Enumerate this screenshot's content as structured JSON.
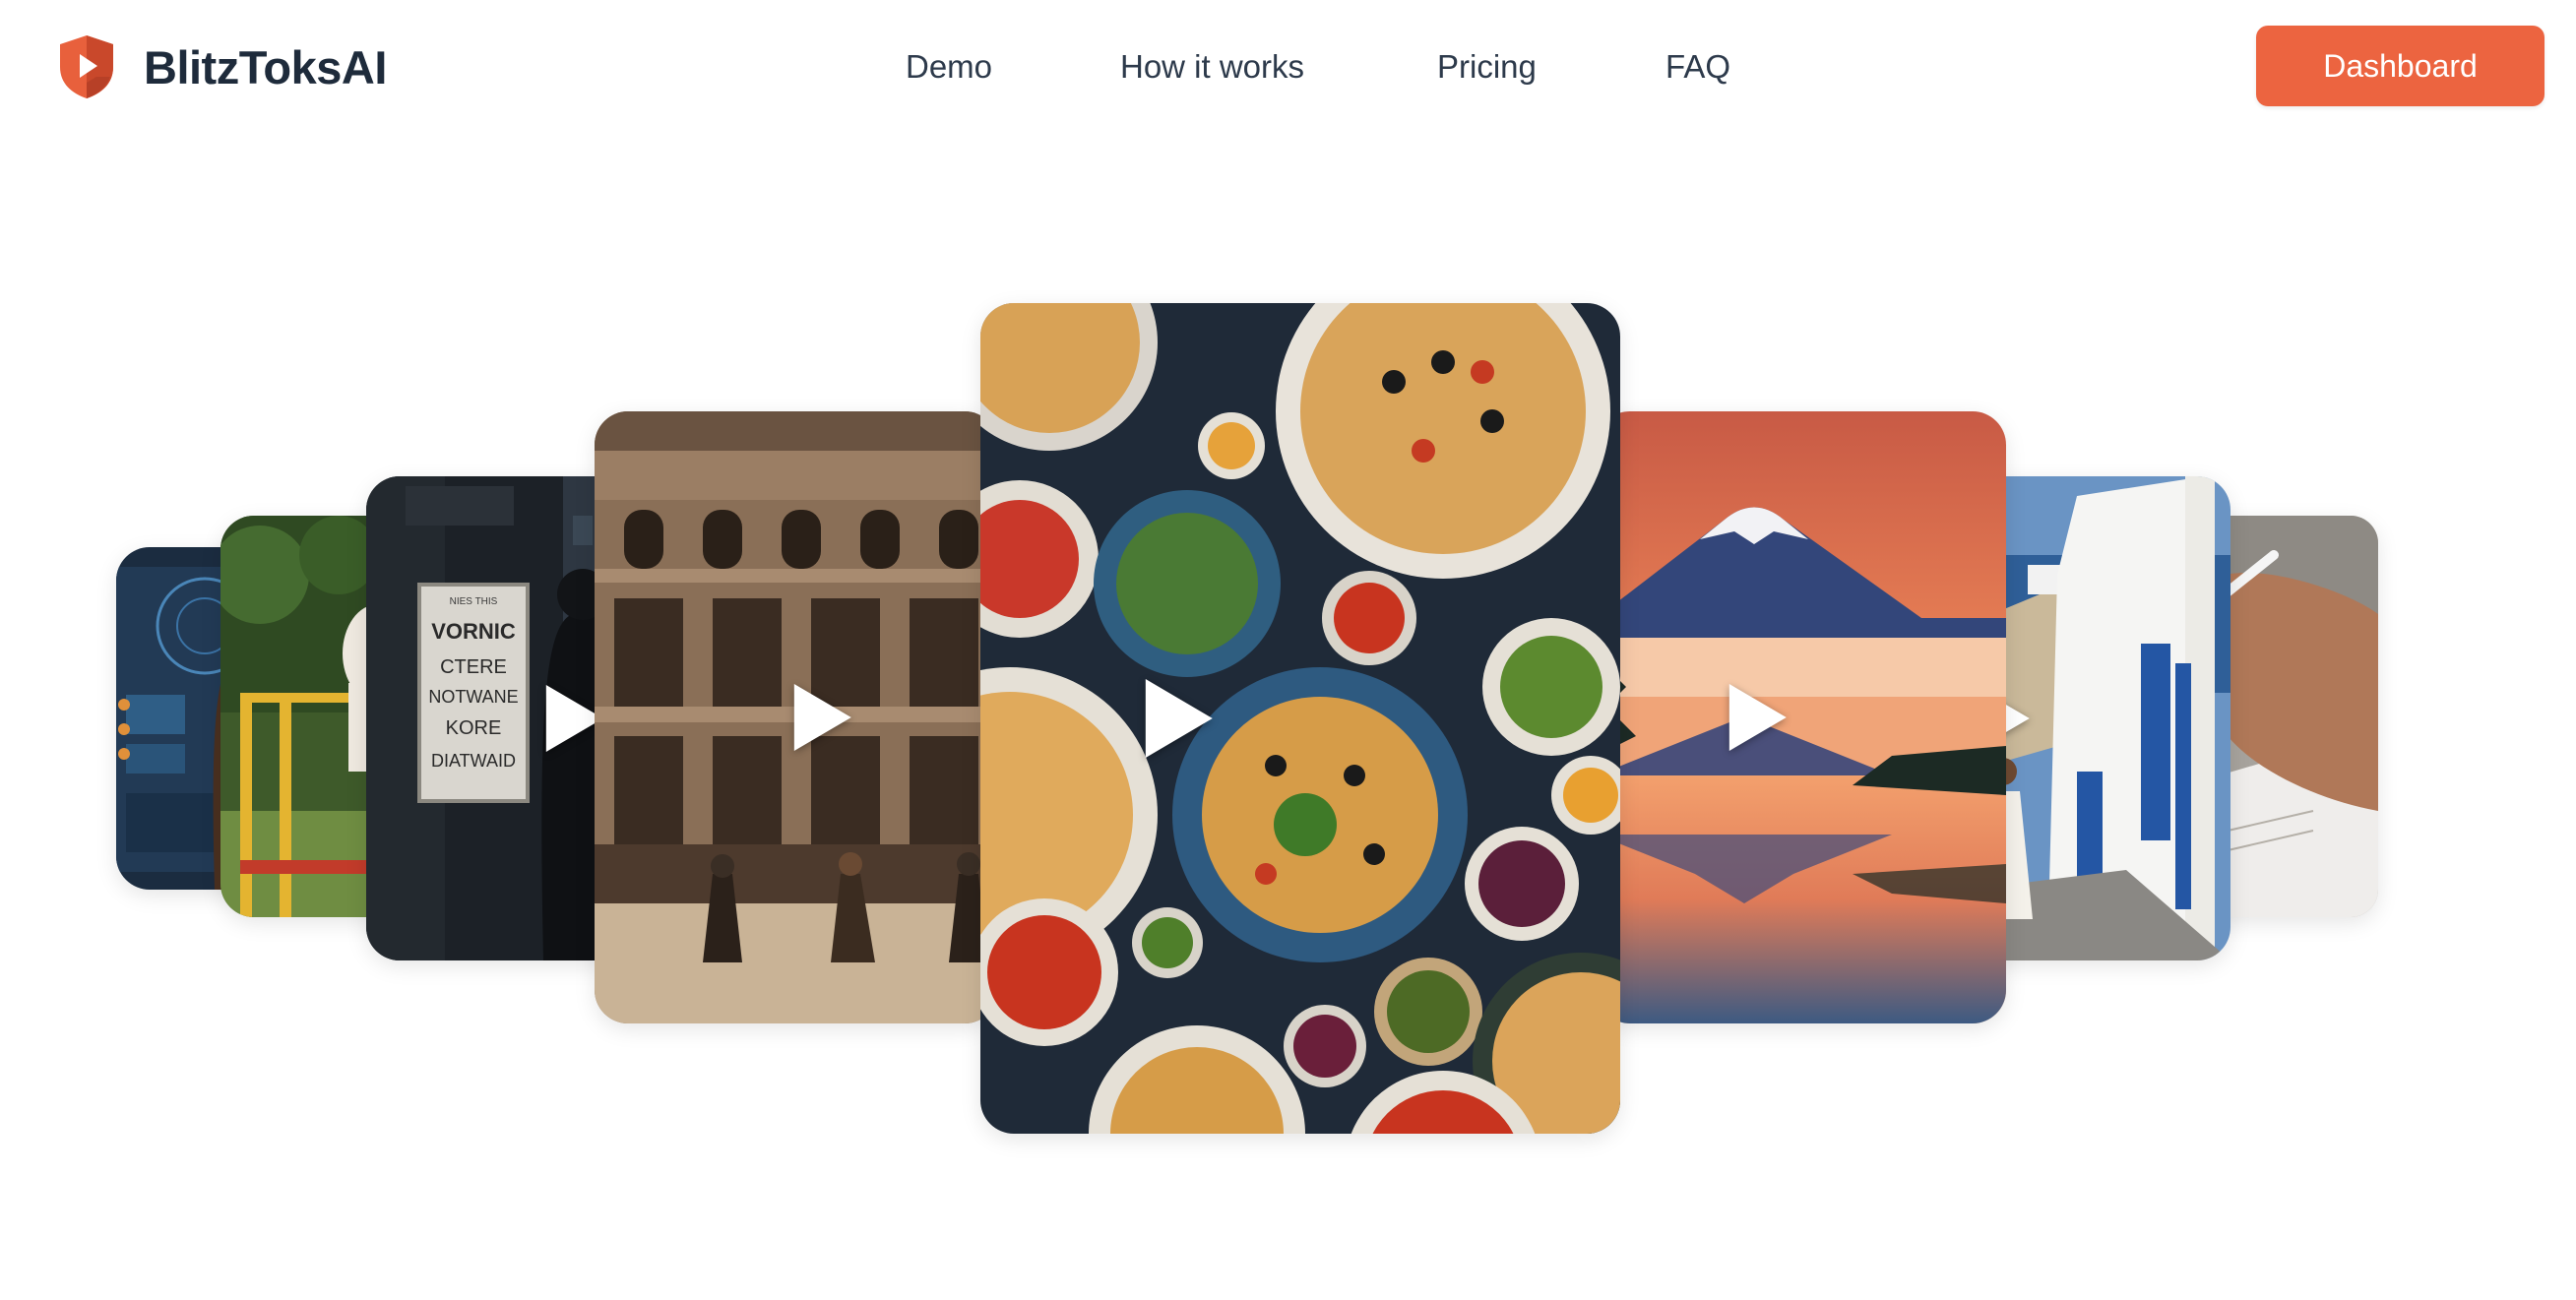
{
  "brand": {
    "name": "BlitzToksAI",
    "accent_color": "#ec6440",
    "logo_icon": "shield-play-icon"
  },
  "nav": {
    "items": [
      {
        "label": "Demo"
      },
      {
        "label": "How it works"
      },
      {
        "label": "Pricing"
      },
      {
        "label": "FAQ"
      }
    ],
    "cta_label": "Dashboard"
  },
  "carousel": {
    "play_icon": "play-icon",
    "cards": [
      {
        "subject": "futuristic control room"
      },
      {
        "subject": "dog jumping over agility hurdle"
      },
      {
        "subject": "hooded figure beside a warning sign",
        "sign_text": "VORNIC\nCTERE\nNOTWANE\nKORE\nDIATWAID"
      },
      {
        "subject": "gladiators fighting in a colosseum"
      },
      {
        "subject": "table of pasta dishes",
        "featured": true
      },
      {
        "subject": "Mount Fuji reflected at sunset"
      },
      {
        "subject": "woman walking through Santorini streets"
      },
      {
        "subject": "hand writing with a pen"
      }
    ]
  }
}
